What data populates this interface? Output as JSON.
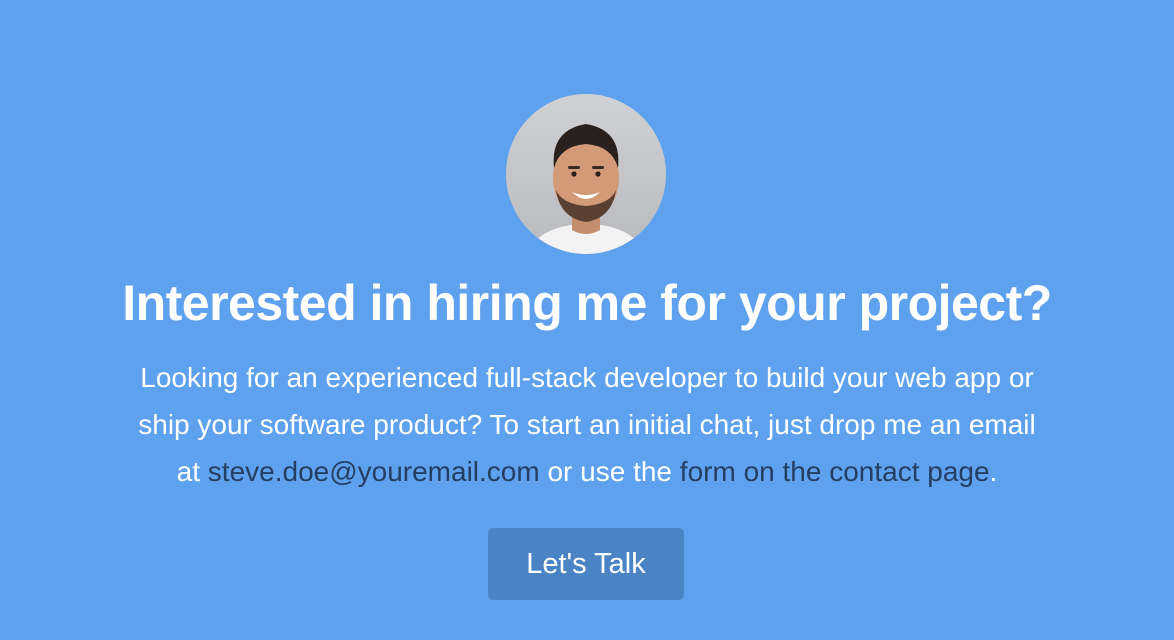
{
  "theme": {
    "background": "#5ea1ee",
    "text": "#ffffff",
    "link": "#253f63",
    "button": "#4a84c4"
  },
  "hero": {
    "title": "Interested in hiring me for your project?",
    "intro_line_1": "Looking for an experienced full-stack developer to build your web app or",
    "intro_line_2": "ship your software product? To start an initial chat, just drop me an email",
    "intro_at": "at ",
    "email_link": "steve.doe@youremail.com",
    "intro_middle": " or use the ",
    "contact_link": "form on the contact page",
    "intro_end": ".",
    "cta_label": "Let's Talk"
  },
  "icons": {
    "avatar": "profile-photo-icon"
  }
}
